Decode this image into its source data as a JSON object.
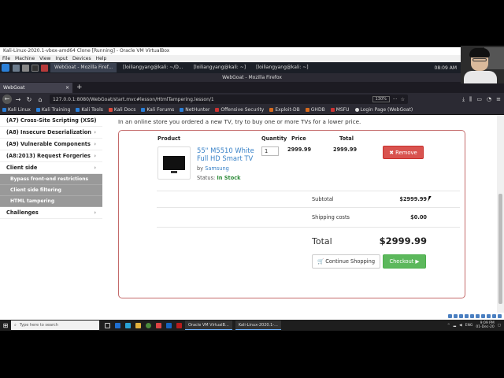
{
  "vbox": {
    "title": "Kali-Linux-2020.1-vbox-amd64 Clone [Running] - Oracle VM VirtualBox",
    "menu": [
      "File",
      "Machine",
      "View",
      "Input",
      "Devices",
      "Help"
    ]
  },
  "kali_panel": {
    "tasks": [
      {
        "label": "WebGoat - Mozilla Firef...",
        "active": true
      },
      {
        "label": "[loiliangyang@kali: ~/D...",
        "active": false
      },
      {
        "label": "[loiliangyang@kali: ~]",
        "active": false
      },
      {
        "label": "[loiliangyang@kali: ~]",
        "active": false
      }
    ],
    "time": "08:09 AM"
  },
  "firefox": {
    "window_title": "WebGoat - Mozilla Firefox",
    "tab_label": "WebGoat",
    "tab_close": "×",
    "new_tab": "+",
    "url": "127.0.0.1:8080/WebGoat/start.mvc#lesson/HtmlTampering.lesson/1",
    "zoom": "130%",
    "bookmarks": [
      "Kali Linux",
      "Kali Training",
      "Kali Tools",
      "Kali Docs",
      "Kali Forums",
      "NetHunter",
      "Offensive Security",
      "Exploit-DB",
      "GHDB",
      "MSFU",
      "Login Page (WebGoat)"
    ]
  },
  "sidebar": {
    "items": [
      {
        "label": "(A7) Cross-Site Scripting (XSS)",
        "chevron": "›"
      },
      {
        "label": "(A8) Insecure Deserialization",
        "chevron": "›"
      },
      {
        "label": "(A9) Vulnerable Components",
        "chevron": "›"
      },
      {
        "label": "(A8:2013) Request Forgeries",
        "chevron": "›"
      },
      {
        "label": "Client side",
        "chevron": "›"
      }
    ],
    "sub_items": [
      "Bypass front-end restrictions",
      "Client side filtering",
      "HTML tampering"
    ],
    "challenges": {
      "label": "Challenges",
      "chevron": "›"
    }
  },
  "lesson": {
    "intro": "In an online store you ordered a new TV, try to buy one or more TVs for a lower price.",
    "headers": {
      "product": "Product",
      "quantity": "Quantity",
      "price": "Price",
      "total": "Total"
    },
    "product": {
      "name": "55\" M5510 White Full HD Smart TV",
      "by_prefix": "by",
      "brand": "Samsung",
      "status_label": "Status:",
      "status_value": "In Stock",
      "quantity": "1",
      "price": "2999.99",
      "total": "2999.99"
    },
    "remove_label": "✖ Remove",
    "subtotal_label": "Subtotal",
    "subtotal_value": "$2999.99",
    "shipping_label": "Shipping costs",
    "shipping_value": "$0.00",
    "total_label": "Total",
    "total_value": "$2999.99",
    "continue_label": "🛒 Continue Shopping",
    "checkout_label": "Checkout ▶"
  },
  "windows": {
    "search_placeholder": "Type here to search",
    "apps": [
      "Oracle VM VirtualB...",
      "Kali-Linux-2020.1-..."
    ],
    "tray_lang": "ENG",
    "time": "9:09 PM",
    "date": "01-Dec-20"
  },
  "colors": {
    "remove": "#d9534f",
    "checkout": "#5cb85c",
    "panel_border": "#c46b6b",
    "link": "#3a83c8",
    "in_stock": "#2e8b3a"
  }
}
